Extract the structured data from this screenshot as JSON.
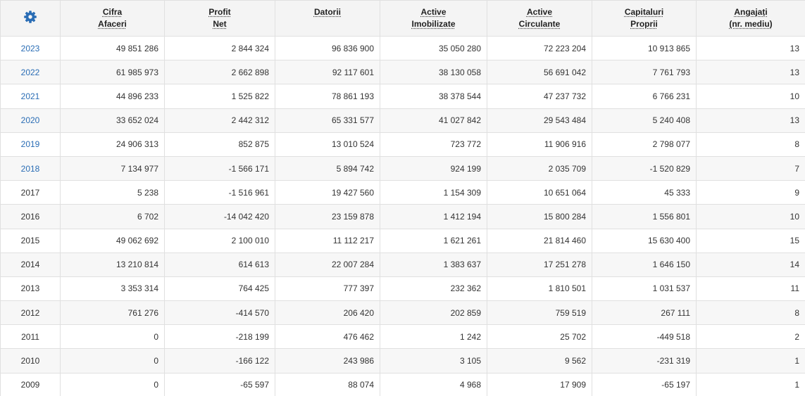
{
  "table": {
    "settings_icon": "gear-icon",
    "accent_color": "#2a6db5",
    "headers": [
      {
        "key": "cifra",
        "line1": "Cifra",
        "line2": "Afaceri"
      },
      {
        "key": "profit",
        "line1": "Profit",
        "line2": "Net"
      },
      {
        "key": "datorii",
        "line1": "Datorii",
        "line2": ""
      },
      {
        "key": "imob",
        "line1": "Active",
        "line2": "Imobilizate"
      },
      {
        "key": "circ",
        "line1": "Active",
        "line2": "Circulante"
      },
      {
        "key": "cap",
        "line1": "Capitaluri",
        "line2": "Proprii"
      },
      {
        "key": "ang",
        "line1": "Angajați",
        "line2": "(nr. mediu)"
      }
    ],
    "rows": [
      {
        "year": "2023",
        "link": true,
        "values": [
          "49 851 286",
          "2 844 324",
          "96 836 900",
          "35 050 280",
          "72 223 204",
          "10 913 865",
          "13"
        ]
      },
      {
        "year": "2022",
        "link": true,
        "values": [
          "61 985 973",
          "2 662 898",
          "92 117 601",
          "38 130 058",
          "56 691 042",
          "7 761 793",
          "13"
        ]
      },
      {
        "year": "2021",
        "link": true,
        "values": [
          "44 896 233",
          "1 525 822",
          "78 861 193",
          "38 378 544",
          "47 237 732",
          "6 766 231",
          "10"
        ]
      },
      {
        "year": "2020",
        "link": true,
        "values": [
          "33 652 024",
          "2 442 312",
          "65 331 577",
          "41 027 842",
          "29 543 484",
          "5 240 408",
          "13"
        ]
      },
      {
        "year": "2019",
        "link": true,
        "values": [
          "24 906 313",
          "852 875",
          "13 010 524",
          "723 772",
          "11 906 916",
          "2 798 077",
          "8"
        ]
      },
      {
        "year": "2018",
        "link": true,
        "values": [
          "7 134 977",
          "-1 566 171",
          "5 894 742",
          "924 199",
          "2 035 709",
          "-1 520 829",
          "7"
        ]
      },
      {
        "year": "2017",
        "link": false,
        "values": [
          "5 238",
          "-1 516 961",
          "19 427 560",
          "1 154 309",
          "10 651 064",
          "45 333",
          "9"
        ]
      },
      {
        "year": "2016",
        "link": false,
        "values": [
          "6 702",
          "-14 042 420",
          "23 159 878",
          "1 412 194",
          "15 800 284",
          "1 556 801",
          "10"
        ]
      },
      {
        "year": "2015",
        "link": false,
        "values": [
          "49 062 692",
          "2 100 010",
          "11 112 217",
          "1 621 261",
          "21 814 460",
          "15 630 400",
          "15"
        ]
      },
      {
        "year": "2014",
        "link": false,
        "values": [
          "13 210 814",
          "614 613",
          "22 007 284",
          "1 383 637",
          "17 251 278",
          "1 646 150",
          "14"
        ]
      },
      {
        "year": "2013",
        "link": false,
        "values": [
          "3 353 314",
          "764 425",
          "777 397",
          "232 362",
          "1 810 501",
          "1 031 537",
          "11"
        ]
      },
      {
        "year": "2012",
        "link": false,
        "values": [
          "761 276",
          "-414 570",
          "206 420",
          "202 859",
          "759 519",
          "267 111",
          "8"
        ]
      },
      {
        "year": "2011",
        "link": false,
        "values": [
          "0",
          "-218 199",
          "476 462",
          "1 242",
          "25 702",
          "-449 518",
          "2"
        ]
      },
      {
        "year": "2010",
        "link": false,
        "values": [
          "0",
          "-166 122",
          "243 986",
          "3 105",
          "9 562",
          "-231 319",
          "1"
        ]
      },
      {
        "year": "2009",
        "link": false,
        "values": [
          "0",
          "-65 597",
          "88 074",
          "4 968",
          "17 909",
          "-65 197",
          "1"
        ]
      }
    ]
  }
}
